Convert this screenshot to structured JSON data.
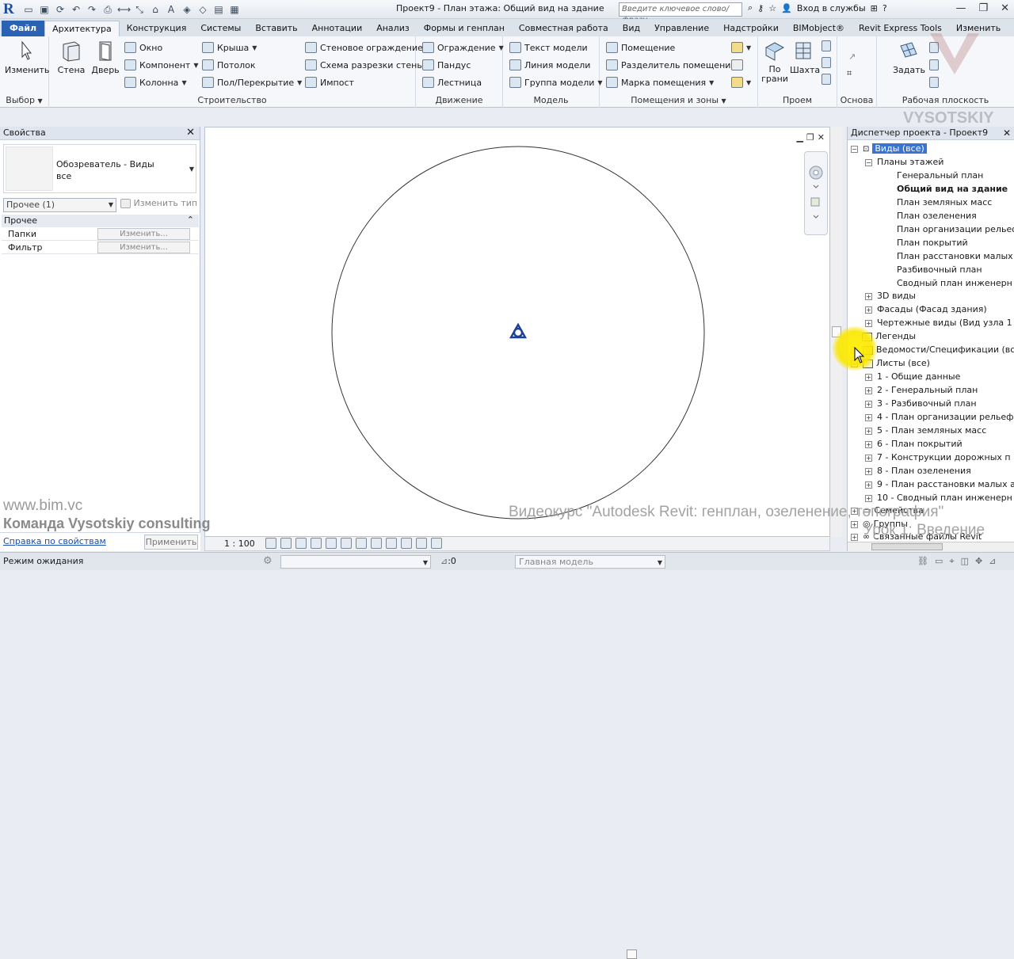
{
  "app": {
    "title": "Проект9 - План этажа: Общий вид на здание",
    "search_placeholder": "Введите ключевое слово/фразу",
    "login": "Вход в службы"
  },
  "tabs": [
    "Файл",
    "Архитектура",
    "Конструкция",
    "Системы",
    "Вставить",
    "Аннотации",
    "Анализ",
    "Формы и генплан",
    "Совместная работа",
    "Вид",
    "Управление",
    "Надстройки",
    "BIMobject®",
    "Revit Express Tools",
    "Изменить"
  ],
  "ribbon": {
    "select": {
      "modify": "Изменить",
      "title": "Выбор"
    },
    "build": {
      "wall": "Стена",
      "door": "Дверь",
      "window": "Окно",
      "component": "Компонент",
      "column": "Колонна",
      "roof": "Крыша",
      "ceiling": "Потолок",
      "floor": "Пол/Перекрытие",
      "curtain_system": "Стеновое ограждение",
      "curtain_grid": "Схема разрезки стены",
      "mullion": "Импост",
      "title": "Строительство"
    },
    "circulation": {
      "railing": "Ограждение",
      "ramp": "Пандус",
      "stair": "Лестница",
      "title": "Движение"
    },
    "model": {
      "text": "Текст модели",
      "line": "Линия модели",
      "group": "Группа модели",
      "title": "Модель"
    },
    "rooms": {
      "room": "Помещение",
      "separator": "Разделитель помещений",
      "tag": "Марка помещения",
      "title": "Помещения и зоны"
    },
    "opening": {
      "by_face": "По\nграни",
      "shaft": "Шахта",
      "title": "Проем"
    },
    "datum": {
      "title": "Основа"
    },
    "workplane": {
      "set": "Задать",
      "title": "Рабочая плоскость"
    }
  },
  "properties": {
    "title": "Свойства",
    "type_name": "Обозреватель - Виды\nвсе",
    "selector": "Прочее (1)",
    "edit_type": "Изменить тип",
    "category": "Прочее",
    "rows": [
      {
        "key": "Папки",
        "value": "Изменить..."
      },
      {
        "key": "Фильтр",
        "value": "Изменить..."
      }
    ],
    "help_link": "Справка по свойствам",
    "apply": "Применить"
  },
  "view": {
    "scale": "1 : 100"
  },
  "browser": {
    "title": "Диспетчер проекта - Проект9",
    "root": "Виды (все)",
    "floor_plans": "Планы этажей",
    "plans": [
      "Генеральный план",
      "Общий вид на здание",
      "План земляных масс",
      "План озеленения",
      "План организации рельеф",
      "План покрытий",
      "План расстановки малых",
      "Разбивочный план",
      "Сводный план инженерн"
    ],
    "views_3d": "3D виды",
    "elevations": "Фасады (Фасад здания)",
    "drafting": "Чертежные виды (Вид узла 1",
    "legends": "Легенды",
    "schedules": "Ведомости/Спецификации (вс",
    "sheets_root": "Листы (все)",
    "sheets": [
      "1 - Общие данные",
      "2 - Генеральный план",
      "3 - Разбивочный план",
      "4 - План организации рельеф",
      "5 - План земляных масс",
      "6 - План покрытий",
      "7 - Конструкции дорожных п",
      "8 - План озеленения",
      "9 - План расстановки малых а",
      "10 - Сводный план инженерн"
    ],
    "families": "Семейства",
    "groups": "Группы",
    "links": "Связанные файлы Revit"
  },
  "status": {
    "text": "Режим ожидания",
    "count": ":0",
    "model": "Главная модель"
  },
  "watermarks": {
    "site": "www.bim.vc",
    "team": "Команда Vysotskiy consulting",
    "course": "Видеокурс \"Autodesk Revit: генплан, озеленение, топография\"",
    "lesson": "Урок 1: Введение",
    "brand": "VYSOTSKIY"
  },
  "colors": {
    "accent": "#2a62b4",
    "marker": "#1c3f9a",
    "highlight": "#f7e300"
  }
}
